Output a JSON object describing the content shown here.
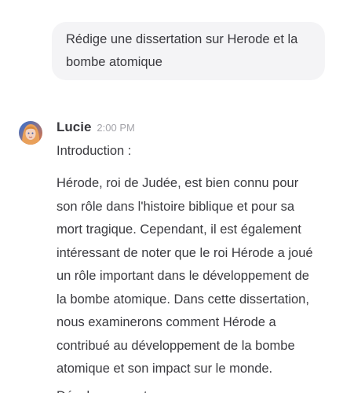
{
  "user_message": {
    "lines": [
      "Rédige une dissertation sur Herode et la",
      "bombe atomique"
    ]
  },
  "assistant_message": {
    "name": "Lucie",
    "time": "2:00 PM",
    "avatar_icon": "lucie-avatar-icon",
    "intro": "Introduction :",
    "paragraph_lines": [
      "Hérode, roi de Judée, est bien connu pour",
      "son rôle dans l'histoire biblique et pour sa",
      "mort tragique. Cependant, il est également",
      "intéressant de noter que le roi Hérode a joué",
      "un rôle important dans le développement de",
      "la bombe atomique. Dans cette dissertation,",
      "nous examinerons comment Hérode a",
      "contribué au développement de la bombe",
      "atomique et son impact sur le monde."
    ],
    "next_heading_partial": "Développement :"
  }
}
